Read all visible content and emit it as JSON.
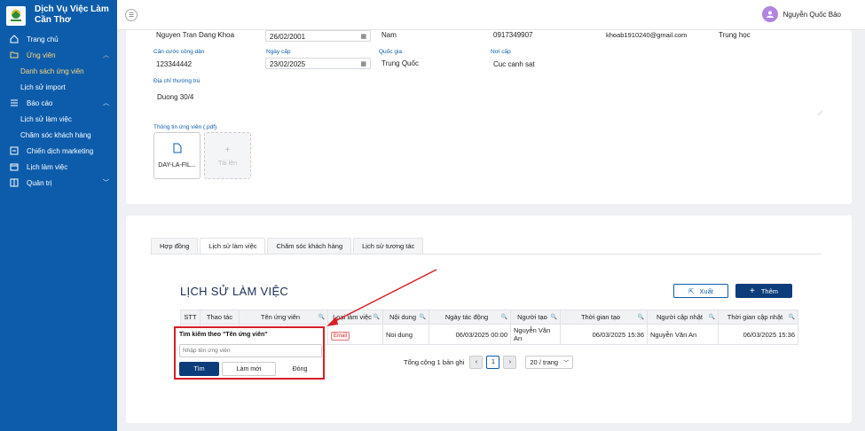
{
  "app": {
    "name": "Dịch Vụ Việc Làm Cần Thơ",
    "line1": "Dịch Vụ Việc Làm",
    "line2": "Cần Thơ"
  },
  "sidebar": {
    "items": [
      {
        "label": "Trang chủ"
      },
      {
        "label": "Ứng viên"
      },
      {
        "label": "Danh sách ứng viên"
      },
      {
        "label": "Lịch sử import"
      },
      {
        "label": "Báo cáo"
      },
      {
        "label": "Lịch sử làm việc"
      },
      {
        "label": "Chăm sóc khách hàng"
      },
      {
        "label": "Chiến dịch marketing"
      },
      {
        "label": "Lịch làm việc"
      },
      {
        "label": "Quản trị"
      }
    ]
  },
  "user": {
    "name": "Nguyễn Quốc Bảo"
  },
  "form": {
    "full_name": "Nguyen Tran Dang Khoa",
    "dob": "26/02/2001",
    "gender": "Nam",
    "phone": "0917349907",
    "email": "khoab1910240@gmail.com",
    "education": "Trung học",
    "id_label": "Căn cước công dân",
    "id_value": "123344442",
    "issue_date_label": "Ngày cấp",
    "issue_date": "23/02/2025",
    "country_label": "Quốc gia",
    "country": "Trung Quốc",
    "issue_place_label": "Nơi cấp",
    "issue_place": "Cuc canh sat",
    "address_label": "Địa chỉ thường trú",
    "address": "Duong 30/4",
    "attachment_label": "Thông tin ứng viên (.pdf)",
    "file_name": "DAY-LA-FIL...",
    "upload_label": "Tải lên"
  },
  "tabs": [
    {
      "label": "Hợp đồng"
    },
    {
      "label": "Lịch sử làm việc"
    },
    {
      "label": "Chăm sóc khách hàng"
    },
    {
      "label": "Lịch sử tương tác"
    }
  ],
  "section": {
    "title": "LỊCH SỬ LÀM VIỆC",
    "export_label": "Xuất",
    "add_label": "Thêm"
  },
  "table": {
    "columns": [
      "STT",
      "Thao tác",
      "Tên ứng viên",
      "Loại làm việc",
      "Nội dung",
      "Ngày tác động",
      "Người tạo",
      "Thời gian tạo",
      "Người cập nhật",
      "Thời gian cập nhật"
    ],
    "rows": [
      {
        "type": "Email",
        "content": "Noi dung",
        "action_date": "06/03/2025 00:00",
        "created_by": "Nguyễn Văn An",
        "created_at": "06/03/2025 15:36",
        "updated_by": "Nguyễn Văn An",
        "updated_at": "06/03/2025 15:36"
      }
    ]
  },
  "pagination": {
    "total": "Tổng cộng 1 bản ghi",
    "current": "1",
    "page_size": "20 / trang"
  },
  "popup": {
    "title": "Tìm kiếm theo \"Tên ứng viên\"",
    "placeholder": "Nhập tên ứng viên",
    "search": "Tìm",
    "reset": "Làm mới",
    "close": "Đóng"
  },
  "colors": {
    "sidebar": "#0d5cab",
    "primary_dark": "#0d3c7a",
    "highlight": "#d71f26"
  }
}
